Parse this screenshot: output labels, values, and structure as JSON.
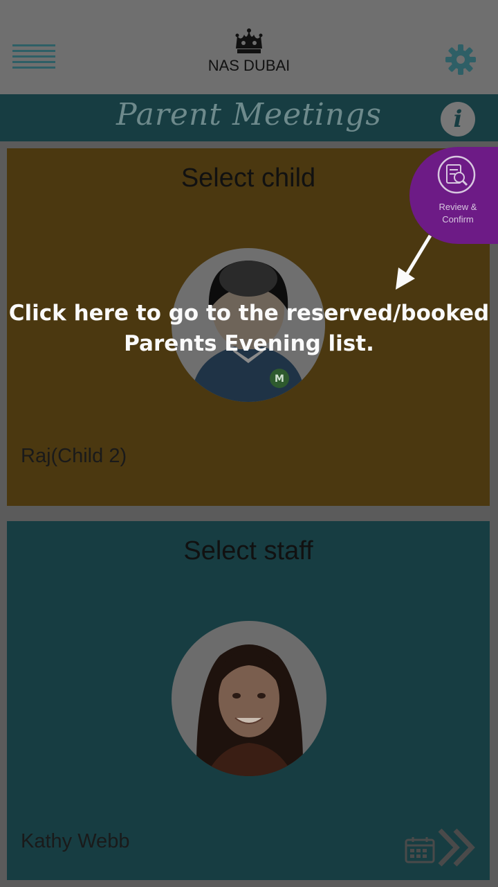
{
  "header": {
    "logo_text": "NAS DUBAI"
  },
  "title_bar": {
    "title": "Parent Meetings",
    "info_glyph": "i"
  },
  "child_card": {
    "title": "Select child",
    "child_name": "Raj(Child 2)",
    "color": "#4b3810"
  },
  "review_button": {
    "label_line1": "Review &",
    "label_line2": "Confirm",
    "color": "#6d1b86"
  },
  "staff_card": {
    "title": "Select staff",
    "staff_name": "Kathy Webb",
    "color": "#173d42"
  },
  "coach_mark": {
    "line1": "Click here to go to the reserved/booked",
    "line2": "Parents Evening list."
  },
  "icons": [
    "menu-icon",
    "crown-logo-icon",
    "gear-icon",
    "info-icon",
    "review-search-icon",
    "calendar-icon",
    "double-chevron-right-icon"
  ]
}
